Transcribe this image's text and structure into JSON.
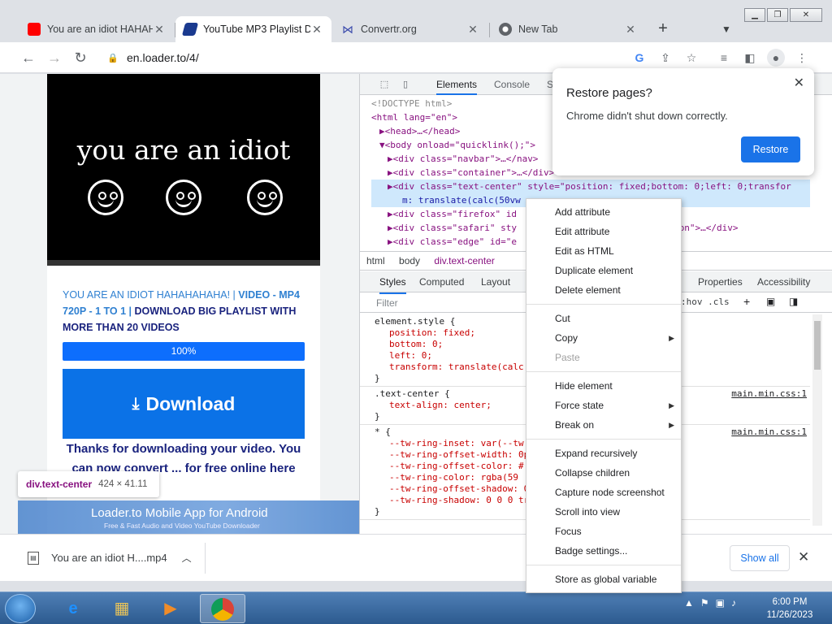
{
  "browser": {
    "tabs": [
      {
        "title": "You are an idiot HAHAHAHAHA!",
        "icon": "youtube-icon",
        "color": "#ff0000",
        "active": false
      },
      {
        "title": "YouTube MP3 Playlist Downloader",
        "icon": "loader-icon",
        "color": "#1a3a8f",
        "active": true
      },
      {
        "title": "Convertr.org",
        "icon": "convertr-icon",
        "color": "#3949ab",
        "active": false
      },
      {
        "title": "New Tab",
        "icon": "chrome-icon",
        "color": "#5f6368",
        "active": false
      }
    ],
    "url": "en.loader.to/4/"
  },
  "page": {
    "video_text": "you are an idiot",
    "title_part1": "YOU ARE AN IDIOT HAHAHAHAHA! | ",
    "title_part2": "VIDEO - MP4 720P - 1 TO 1 | ",
    "title_part3": "DOWNLOAD BIG PLAYLIST WITH MORE THAN 20 VIDEOS",
    "progress_label": "100%",
    "download_label": "Download",
    "thanks_text": "Thanks for downloading your video. You can now convert ... for free online here",
    "ad_title": "Loader.to Mobile App for Android",
    "ad_subtitle": "Free & Fast Audio and Video YouTube Downloader"
  },
  "tooltip": {
    "selector": "div.text-center",
    "dims": "424 × 41.11"
  },
  "devtools": {
    "tabs": [
      "Elements",
      "Console",
      "S"
    ],
    "tree": {
      "doctype": "<!DOCTYPE html>",
      "html": "<html lang=\"en\">",
      "head": "<head>…</head>",
      "body": "<body onload=\"quicklink();\">",
      "nav": "<div class=\"navbar\">…</nav>",
      "container": "<div class=\"container\">…</div>",
      "selected_line1": "<div class=\"text-center\" style=\"position: fixed;bottom: 0;left: 0;transfor",
      "selected_line2": "m: translate(calc(50vw",
      "firefox": "<div class=\"firefox\" id",
      "safari": "<div class=\"safari\" sty",
      "safari_end": "ri_addon\">…</div>",
      "edge": "<div class=\"edge\" id=\"e"
    },
    "crumbs": [
      "html",
      "body",
      "div.text-center"
    ],
    "style_tabs": [
      "Styles",
      "Computed",
      "Layout",
      "Properties",
      "Accessibility"
    ],
    "filter_placeholder": "Filter",
    "hov_cls": ":hov  .cls",
    "rules": {
      "r1_selector": "element.style {",
      "r1_props": [
        "position: fixed;",
        "bottom: 0;",
        "left: 0;",
        "transform: translate(calc"
      ],
      "r2_selector": ".text-center {",
      "r2_props": [
        "text-align: center;"
      ],
      "r2_src": "main.min.css:1",
      "r3_selector": "* {",
      "r3_props": [
        "--tw-ring-inset: var(--tw",
        "--tw-ring-offset-width: 0p",
        "--tw-ring-offset-color: #",
        "--tw-ring-color: rgba(59",
        "--tw-ring-offset-shadow: 0",
        "--tw-ring-shadow: 0 0 0 tr"
      ],
      "r3_src": "main.min.css:1",
      "close_brace": "}"
    }
  },
  "restore": {
    "title": "Restore pages?",
    "message": "Chrome didn't shut down correctly.",
    "button": "Restore"
  },
  "context_menu": {
    "g1": [
      "Add attribute",
      "Edit attribute",
      "Edit as HTML",
      "Duplicate element",
      "Delete element"
    ],
    "g2": [
      "Cut",
      "Copy",
      "Paste"
    ],
    "g3": [
      "Hide element",
      "Force state",
      "Break on"
    ],
    "g4": [
      "Expand recursively",
      "Collapse children",
      "Capture node screenshot",
      "Scroll into view",
      "Focus",
      "Badge settings..."
    ],
    "g5": [
      "Store as global variable"
    ]
  },
  "downloads": {
    "file": "You are an idiot H....mp4",
    "show_all": "Show all"
  },
  "taskbar": {
    "time": "6:00 PM",
    "date": "11/26/2023"
  }
}
